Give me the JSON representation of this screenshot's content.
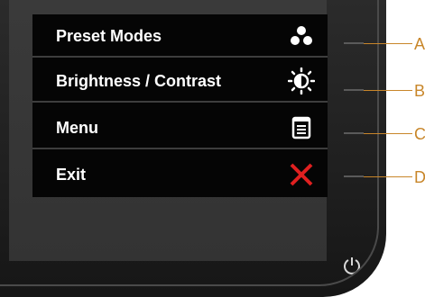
{
  "osd": {
    "items": [
      {
        "label": "Preset Modes",
        "icon": "preset-modes-icon"
      },
      {
        "label": "Brightness / Contrast",
        "icon": "brightness-contrast-icon"
      },
      {
        "label": "Menu",
        "icon": "menu-icon"
      },
      {
        "label": "Exit",
        "icon": "exit-icon"
      }
    ]
  },
  "callouts": [
    "A",
    "B",
    "C",
    "D"
  ],
  "colors": {
    "osd_background": "#050505",
    "label_text": "#ffffff",
    "exit_icon": "#e02020",
    "callout": "#c8862a",
    "bezel": "#2b2b2b"
  },
  "power_icon": "power-icon"
}
